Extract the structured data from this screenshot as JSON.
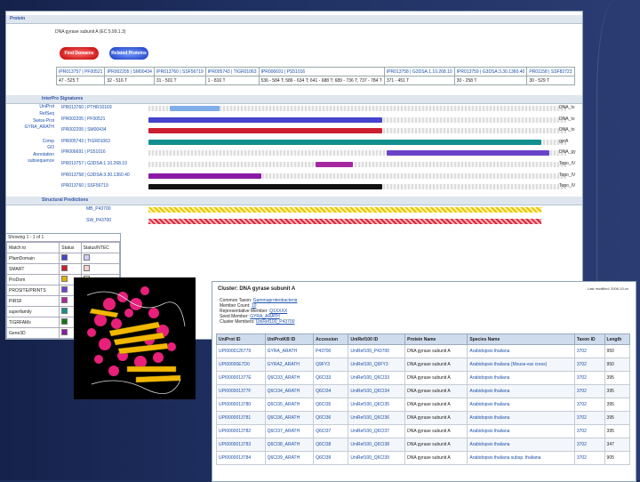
{
  "interpro": {
    "section_protein": "Protein",
    "description": "DNA gyrase subunit A (EC 5.99.1.3)",
    "btn_find_domains": "Find Domains",
    "btn_related": "Related Proteins",
    "ids": [
      {
        "ids": "IPR013757 | PF00521",
        "range": "47 - 525 T"
      },
      {
        "ids": "IPR002205 | SM00434",
        "range": "32 - 516 T"
      },
      {
        "ids": "IPR013760 | SSF56719",
        "range": "31 - 501 T"
      },
      {
        "ids": "IPR005743 | TIGR01063",
        "range": "1 - 816 T"
      },
      {
        "ids": "IPR006691 | PS51016",
        "range": "536 - 584 T; 586 - 634 T; 641 - 688 T; 689 - 736 T; 737 - 784 T"
      },
      {
        "ids": "IPR013758 | G3DSA:1.10.268.10",
        "range": "371 - 451 T"
      },
      {
        "ids": "IPR013759 | G3DSA:3.30.1360.40",
        "range": "30 - 258 T"
      },
      {
        "ids": "PR01158 | SSF82723",
        "range": "30 - 529 T"
      }
    ],
    "section_supermatch": "InterPro Signatures",
    "section_structural": "Structural Predictions",
    "left_links": [
      "UniProt",
      "RefSeq",
      "Swiss-Prot",
      "GYRA_ARATH",
      "Comp",
      "GO",
      "Annotation",
      "subsequence"
    ],
    "signatures": [
      {
        "id": "IPR013760 | PTHR10169",
        "label": "DNA_to",
        "color": "#7faee8",
        "start": 0.05,
        "end": 0.17
      },
      {
        "id": "IPR002205 | PF00521",
        "label": "DNA_to",
        "color": "#4444cc",
        "start": 0.0,
        "end": 0.56
      },
      {
        "id": "IPR002205 | SM00434",
        "label": "DNA_to",
        "color": "#cc1f2f",
        "start": 0.0,
        "end": 0.56
      },
      {
        "id": "IPR005743 | TIGR01063",
        "label": "gyrA",
        "color": "#129090",
        "start": 0.0,
        "end": 0.94
      },
      {
        "id": "IPR006691 | PS51016",
        "label": "DNA_gy",
        "color": "#6a44c8",
        "start": 0.57,
        "end": 0.96
      },
      {
        "id": "IPR013757 | G3DSA:1.10.268.10",
        "label": "Topo_IV",
        "color": "#a628a0",
        "start": 0.4,
        "end": 0.49
      },
      {
        "id": "IPR013758 | G3DSA:3.30.1360.40",
        "label": "Topo_IV",
        "color": "#8a1aa5",
        "start": 0.0,
        "end": 0.27
      },
      {
        "id": "IPR013760 | SSF56719",
        "label": "Topo_IV",
        "color": "#111111",
        "start": 0.0,
        "end": 0.56
      }
    ],
    "structural": [
      {
        "id": "MB_P43700",
        "style": "yellow"
      },
      {
        "id": "SW_P43700",
        "style": "red"
      }
    ]
  },
  "legend": {
    "showing": "Showing 1 - 1 of 1",
    "headers": [
      "Match to",
      "Status",
      "Status/NTEC"
    ],
    "rows": [
      {
        "name": "PfamDomain",
        "c1": "#4444cc",
        "c2": "#d0d0ff"
      },
      {
        "name": "SMART",
        "c1": "#cc1f2f",
        "c2": "#ffd0d0"
      },
      {
        "name": "ProDom",
        "c1": "#e0b000",
        "c2": "#fff0b0"
      },
      {
        "name": "PROSITE/PRINTS",
        "c1": "#6a44c8",
        "c2": "#e0d8ff"
      },
      {
        "name": "PIRSF",
        "c1": "#a628a0",
        "c2": "#f0d0f0"
      },
      {
        "name": "superfamily",
        "c1": "#129090",
        "c2": "#c8f0f0"
      },
      {
        "name": "TIGRFAMs",
        "c1": "#117711",
        "c2": "#c8f0c8"
      },
      {
        "name": "Gene3D",
        "c1": "#8a1aa5",
        "c2": "#e8d0f0"
      }
    ]
  },
  "cluster": {
    "title": "Cluster: DNA gyrase subunit A",
    "toplinks": "Last modified: 2006-10-xx",
    "meta": [
      {
        "k": "Common Taxon:",
        "v": "Gammaproteobacteria"
      },
      {
        "k": "Member Count:",
        "v": "10"
      },
      {
        "k": "Representative Member:",
        "v": "Q1XXXX"
      },
      {
        "k": "Seed Member:",
        "v": "GYRA_ARATH"
      },
      {
        "k": "Cluster Members:",
        "v": "UniRef100_P43700"
      }
    ],
    "headers": [
      "UniProt ID",
      "UniProtKB ID",
      "Accession",
      "UniRef100 ID",
      "Protein Name",
      "Species Name",
      "Taxon ID",
      "Length"
    ],
    "rows": [
      [
        "UPI0000126779",
        "GYRA_ARATH",
        "P43700",
        "UniRef100_P43700",
        "DNA gyrase subunit A",
        "Arabidopsis thaliana",
        "3702",
        "950"
      ],
      [
        "UPI00000E7D0",
        "GYRA2_ARATH",
        "Q9FY3",
        "UniRef100_Q9FY3",
        "DNA gyrase subunit A",
        "Arabidopsis thaliana (Mouse-ear cress)",
        "3702",
        "950"
      ],
      [
        "UPI000001377E",
        "Q6CI33_ARATH",
        "Q6CI33",
        "UniRef100_Q6CI33",
        "DNA gyrase subunit A",
        "Arabidopsis thaliana",
        "3702",
        "395"
      ],
      [
        "UPI000001377F",
        "Q6CI34_ARATH",
        "Q6CI34",
        "UniRef100_Q6CI34",
        "DNA gyrase subunit A",
        "Arabidopsis thaliana",
        "3702",
        "395"
      ],
      [
        "UPI0000013780",
        "Q6CI35_ARATH",
        "Q6CI35",
        "UniRef100_Q6CI35",
        "DNA gyrase subunit A",
        "Arabidopsis thaliana",
        "3702",
        "395"
      ],
      [
        "UPI0000013781",
        "Q6CI36_ARATH",
        "Q6CI36",
        "UniRef100_Q6CI36",
        "DNA gyrase subunit A",
        "Arabidopsis thaliana",
        "3702",
        "395"
      ],
      [
        "UPI0000013782",
        "Q6CI37_ARATH",
        "Q6CI37",
        "UniRef100_Q6CI37",
        "DNA gyrase subunit A",
        "Arabidopsis thaliana",
        "3702",
        "395"
      ],
      [
        "UPI0000013783",
        "Q6CI38_ARATH",
        "Q6CI38",
        "UniRef100_Q6CI38",
        "DNA gyrase subunit A",
        "Arabidopsis thaliana",
        "3702",
        "347"
      ],
      [
        "UPI0000013784",
        "Q6CI39_ARATH",
        "Q6CI39",
        "UniRef100_Q6CI39",
        "DNA gyrase subunit A",
        "Arabidopsis thaliana subsp. thaliana",
        "3702",
        "905"
      ]
    ]
  }
}
